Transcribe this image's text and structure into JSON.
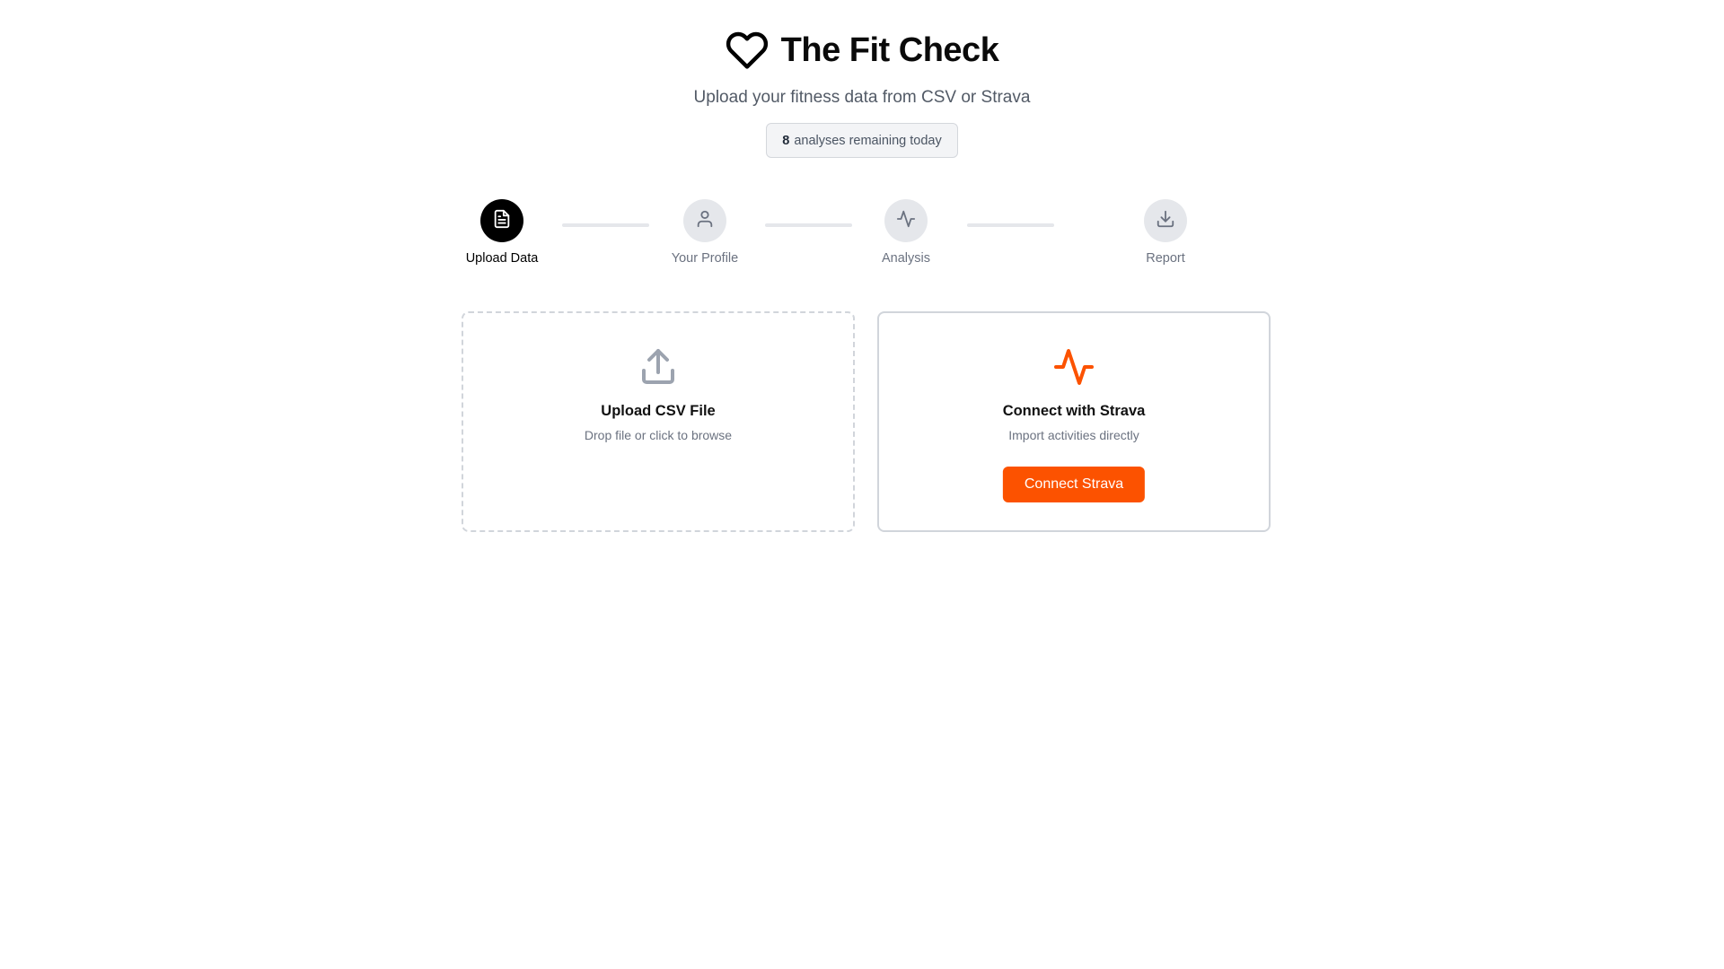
{
  "app": {
    "title": "The Fit Check",
    "logo_icon": "heart-icon",
    "subtitle": "Upload your fitness data from CSV or Strava"
  },
  "quota": {
    "count": "8",
    "text": "analyses remaining today"
  },
  "steps": [
    {
      "label": "Upload Data",
      "icon": "file-text-icon",
      "active": true
    },
    {
      "label": "Your Profile",
      "icon": "user-icon",
      "active": false
    },
    {
      "label": "Analysis",
      "icon": "activity-icon",
      "active": false
    },
    {
      "label": "Report",
      "icon": "download-icon",
      "active": false
    }
  ],
  "upload_card": {
    "icon": "upload-icon",
    "title": "Upload CSV File",
    "subtitle": "Drop file or click to browse"
  },
  "strava_card": {
    "icon": "activity-icon",
    "title": "Connect with Strava",
    "subtitle": "Import activities directly",
    "button_label": "Connect Strava"
  },
  "colors": {
    "strava_orange": "#fc5200",
    "step_active": "#000000",
    "step_inactive": "#e5e7eb",
    "muted_text": "#6b7280"
  }
}
